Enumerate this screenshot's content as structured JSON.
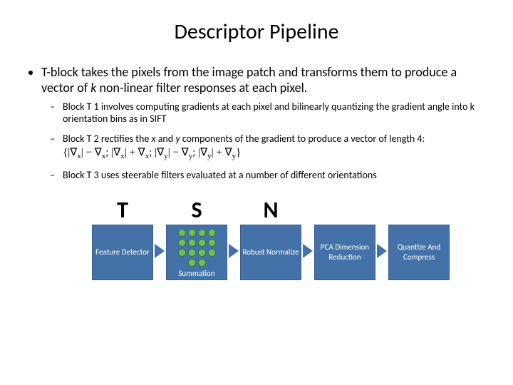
{
  "slide": {
    "title": "Descriptor Pipeline",
    "bullet_main_prefix": "T-block",
    "bullet_main_mid": " takes the pixels from the image patch and transforms them to produce a vector of ",
    "bullet_main_k": "k",
    "bullet_main_suffix": " non-linear filter responses at each pixel.",
    "sub1": "Block T 1 involves computing gradients at each pixel and bilinearly quantizing the gradient angle into k orientation bins as in SIFT",
    "sub2_prefix": "Block T 2 rectifies the ",
    "sub2_x": "x",
    "sub2_mid1": " and ",
    "sub2_y": "y",
    "sub2_mid2": " components of the gradient to produce a vector of length 4:",
    "formula": "{|∇x| − ∇x; |∇x| + ∇x; |∇y| − ∇y; |∇y| + ∇y}",
    "sub3": "Block T 3 uses steerable filters evaluated at a number of different orientations"
  },
  "pipeline": {
    "stage1": {
      "letter": "T",
      "label": "Feature Detector"
    },
    "stage2": {
      "letter": "S",
      "label": "Summation"
    },
    "stage3": {
      "letter": "N",
      "label": "Robust Normalize"
    },
    "stage4": {
      "letter": "",
      "label": "PCA Dimension Reduction"
    },
    "stage5": {
      "letter": "",
      "label": "Quantize And Compress"
    }
  }
}
